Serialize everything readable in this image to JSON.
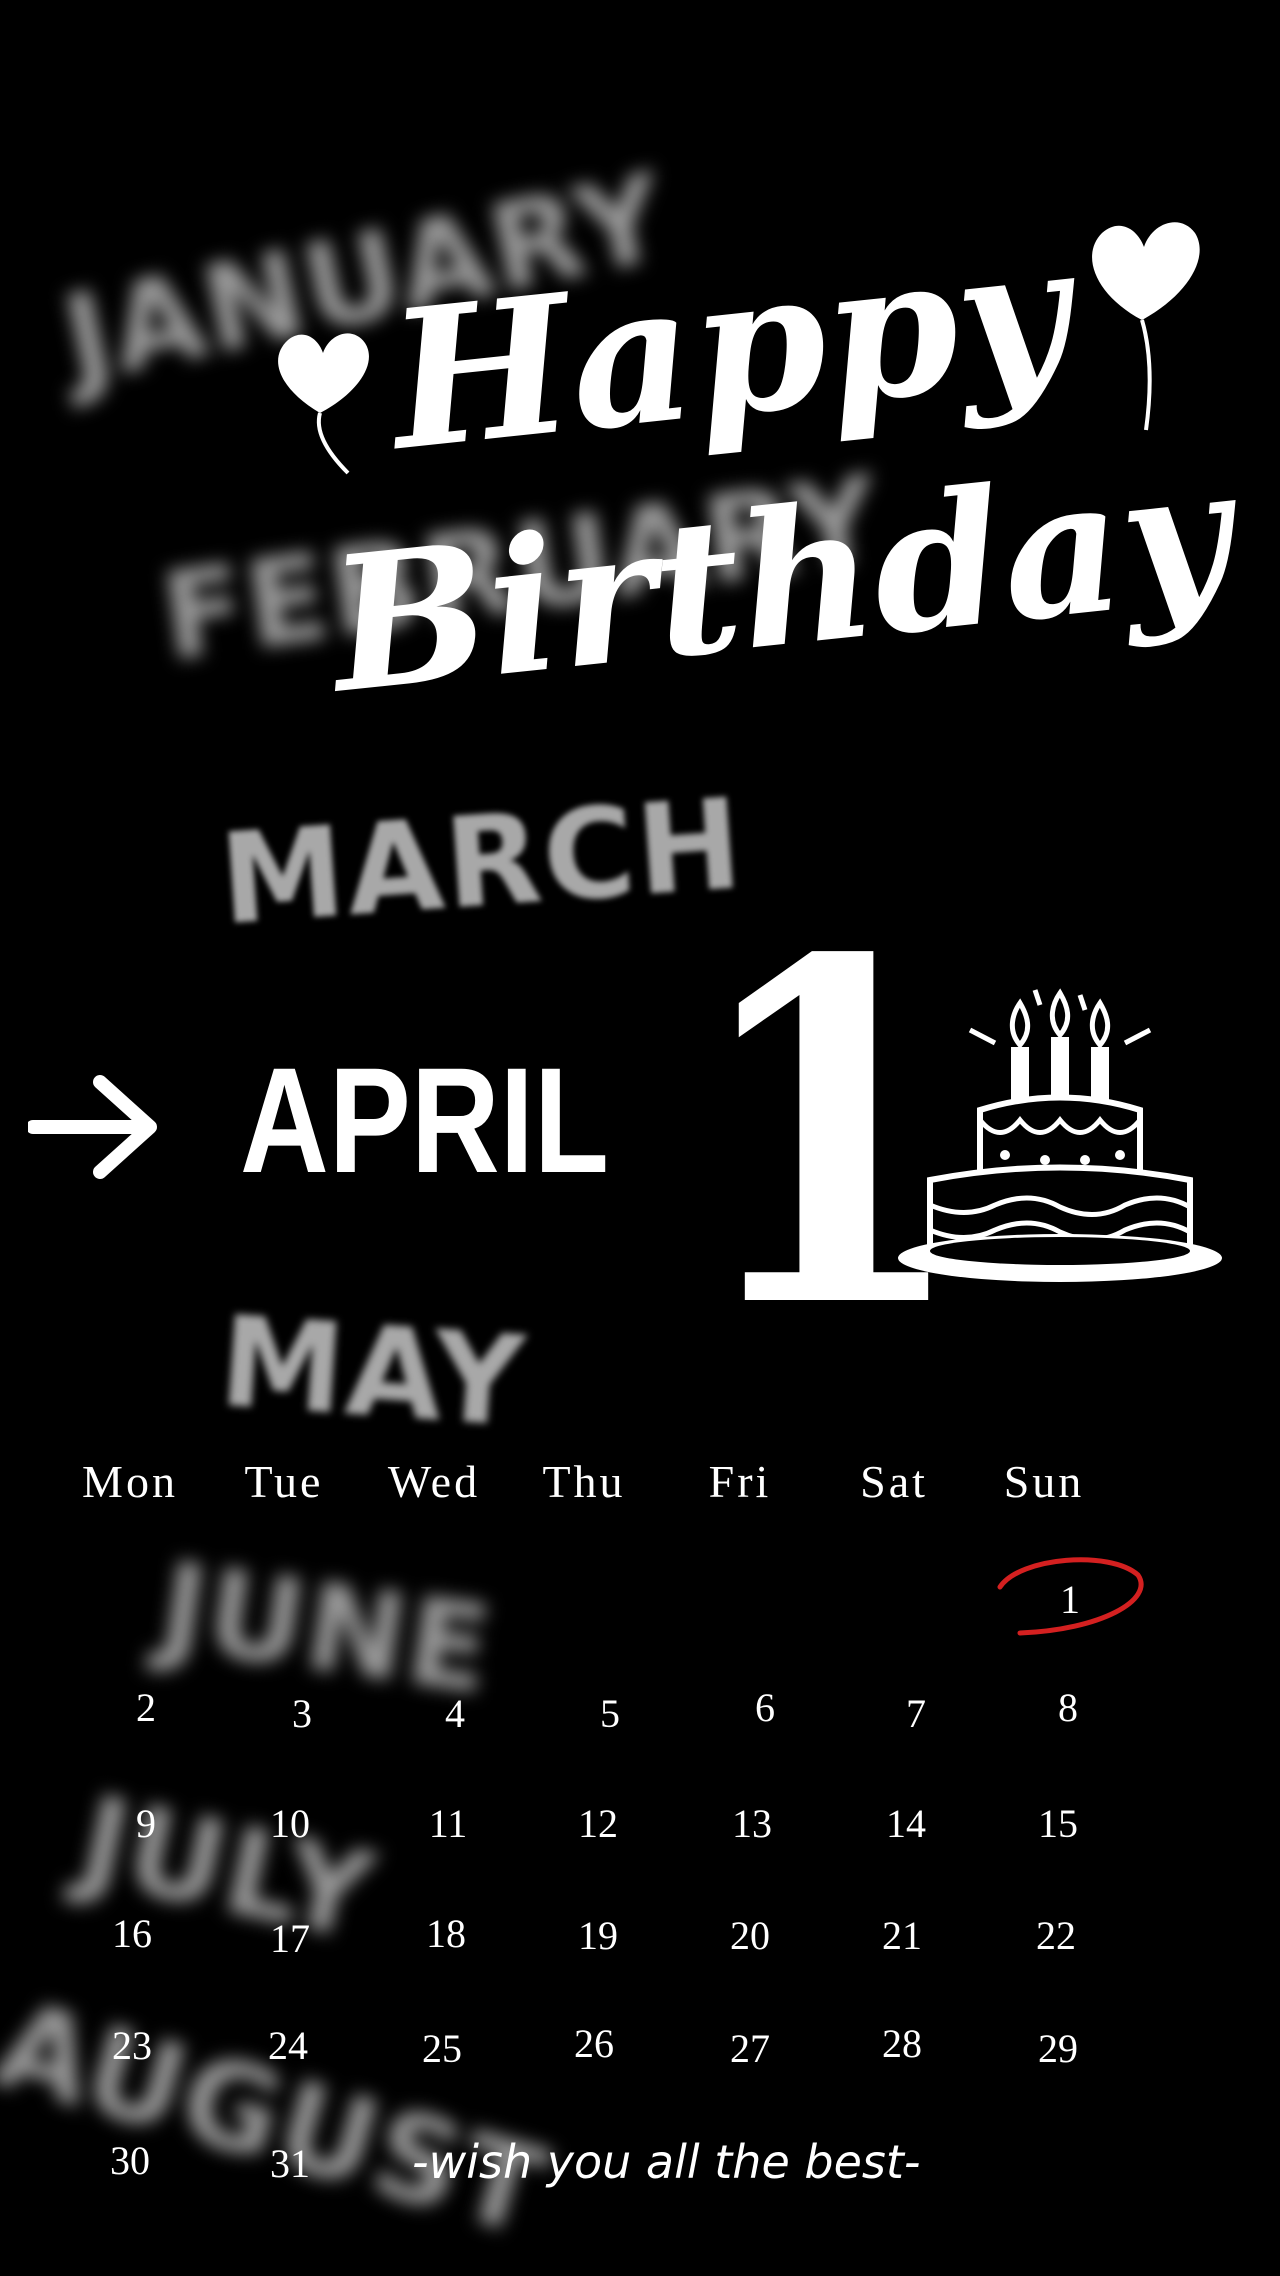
{
  "background_color": "#000000",
  "title": {
    "line1": "Happy",
    "line2": "Birthday"
  },
  "months": {
    "blurred_above": [
      "JANUARY",
      "FEBRUARY",
      "MARCH"
    ],
    "current": "APRIL",
    "blurred_below": [
      "MAY",
      "JUNE",
      "JULY",
      "AUGUST"
    ]
  },
  "big_day": "1",
  "calendar": {
    "weekdays": [
      "Mon",
      "Tue",
      "Wed",
      "Thu",
      "Fri",
      "Sat",
      "Sun"
    ],
    "days": [
      "1",
      "2",
      "3",
      "4",
      "5",
      "6",
      "7",
      "8",
      "9",
      "10",
      "11",
      "12",
      "13",
      "14",
      "15",
      "16",
      "17",
      "18",
      "19",
      "20",
      "21",
      "22",
      "23",
      "24",
      "25",
      "26",
      "27",
      "28",
      "29",
      "30",
      "31"
    ],
    "highlighted_day": "1",
    "highlight_color": "#d42020"
  },
  "wish": "-wish you all the best-",
  "icons": [
    "arrow-right-icon",
    "birthday-cake-icon",
    "heart-balloon-icon"
  ]
}
